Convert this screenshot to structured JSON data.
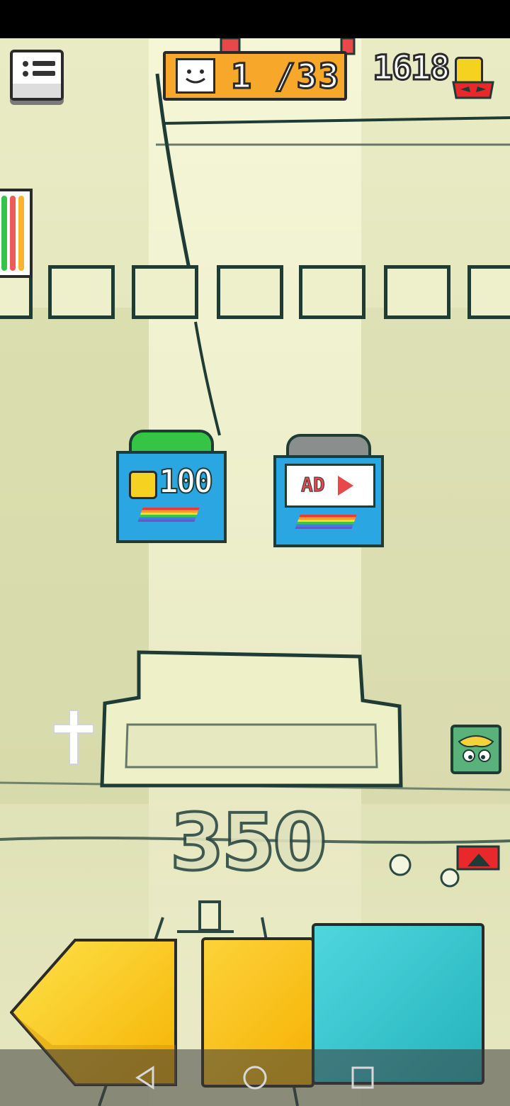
{
  "hud": {
    "level_current": "1",
    "level_text": "1 /33",
    "coins": "1618"
  },
  "shop": {
    "coin_card": {
      "price": "100"
    },
    "ad_card": {
      "label": "AD"
    }
  },
  "score": "350",
  "controls": {
    "left_label": "",
    "jump_label": "",
    "action_label": ""
  },
  "navbar": {
    "back_icon": "triangle-back",
    "home_icon": "circle-home",
    "recents_icon": "square-recents"
  },
  "colors": {
    "accent_orange": "#f7a72a",
    "coin_yellow": "#f5d21f",
    "card_blue": "#2aa6e3",
    "control_yellow": "#fcd23a",
    "control_teal": "#4fd6df"
  }
}
